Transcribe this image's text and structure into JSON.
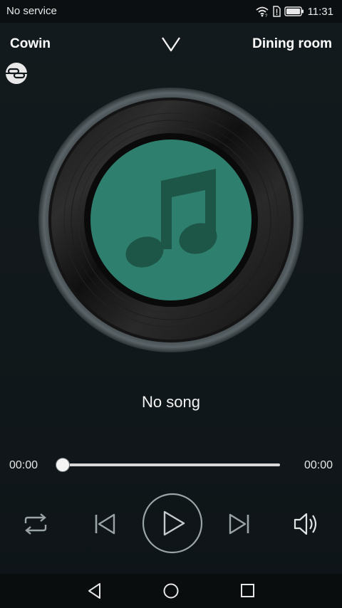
{
  "status_bar": {
    "carrier": "No service",
    "time": "11:31",
    "icons": [
      "wifi-icon",
      "sim-alert-icon",
      "battery-icon"
    ]
  },
  "header": {
    "device_name": "Cowin",
    "room_name": "Dining room",
    "collapse_icon": "chevron-down-icon",
    "link_icon": "link-icon"
  },
  "player": {
    "song_title": "No song",
    "time_current": "00:00",
    "time_total": "00:00",
    "progress": 0.0,
    "album_art_icon": "music-note-icon"
  },
  "controls": {
    "repeat_icon": "repeat-icon",
    "prev_icon": "skip-previous-icon",
    "play_icon": "play-icon",
    "next_icon": "skip-next-icon",
    "volume_icon": "volume-icon"
  },
  "nav_bar": {
    "icons": [
      "back-icon",
      "home-icon",
      "recent-apps-icon"
    ]
  },
  "colors": {
    "background": "#11181b",
    "album_green": "#2e7f6d",
    "note_dark": "#1d5647",
    "icon_gray": "#9aa3a6"
  }
}
